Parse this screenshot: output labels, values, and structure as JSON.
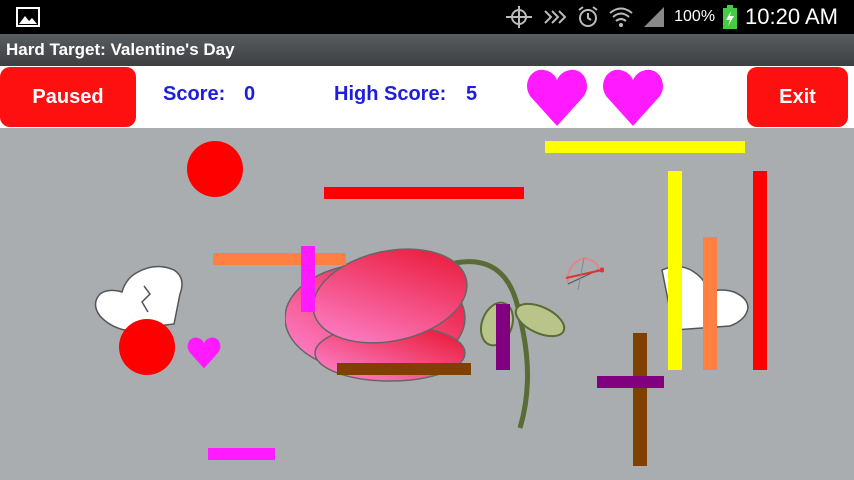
{
  "status_bar": {
    "battery_text": "100%",
    "time": "10:20 AM",
    "icons": [
      "gallery-icon",
      "gps-icon",
      "signal-mute-icon",
      "alarm-icon",
      "wifi-icon",
      "cell-signal-icon",
      "battery-charging-icon"
    ]
  },
  "app": {
    "title": "Hard Target: Valentine's Day"
  },
  "hud": {
    "pause_label": "Paused",
    "exit_label": "Exit",
    "score_label": "Score:",
    "score_value": "0",
    "high_score_label": "High Score:",
    "high_score_value": "5",
    "lives": 2
  },
  "colors": {
    "accent_red": "#ff1010",
    "score_blue": "#1d1ddb",
    "heart_magenta": "#ff1aff",
    "background_gray": "#a9adb0"
  },
  "game": {
    "objects": [
      "rose",
      "winged-heart-left",
      "winged-heart-right",
      "cupid-bow",
      "small-heart",
      "red-ball-1",
      "red-ball-2"
    ]
  }
}
